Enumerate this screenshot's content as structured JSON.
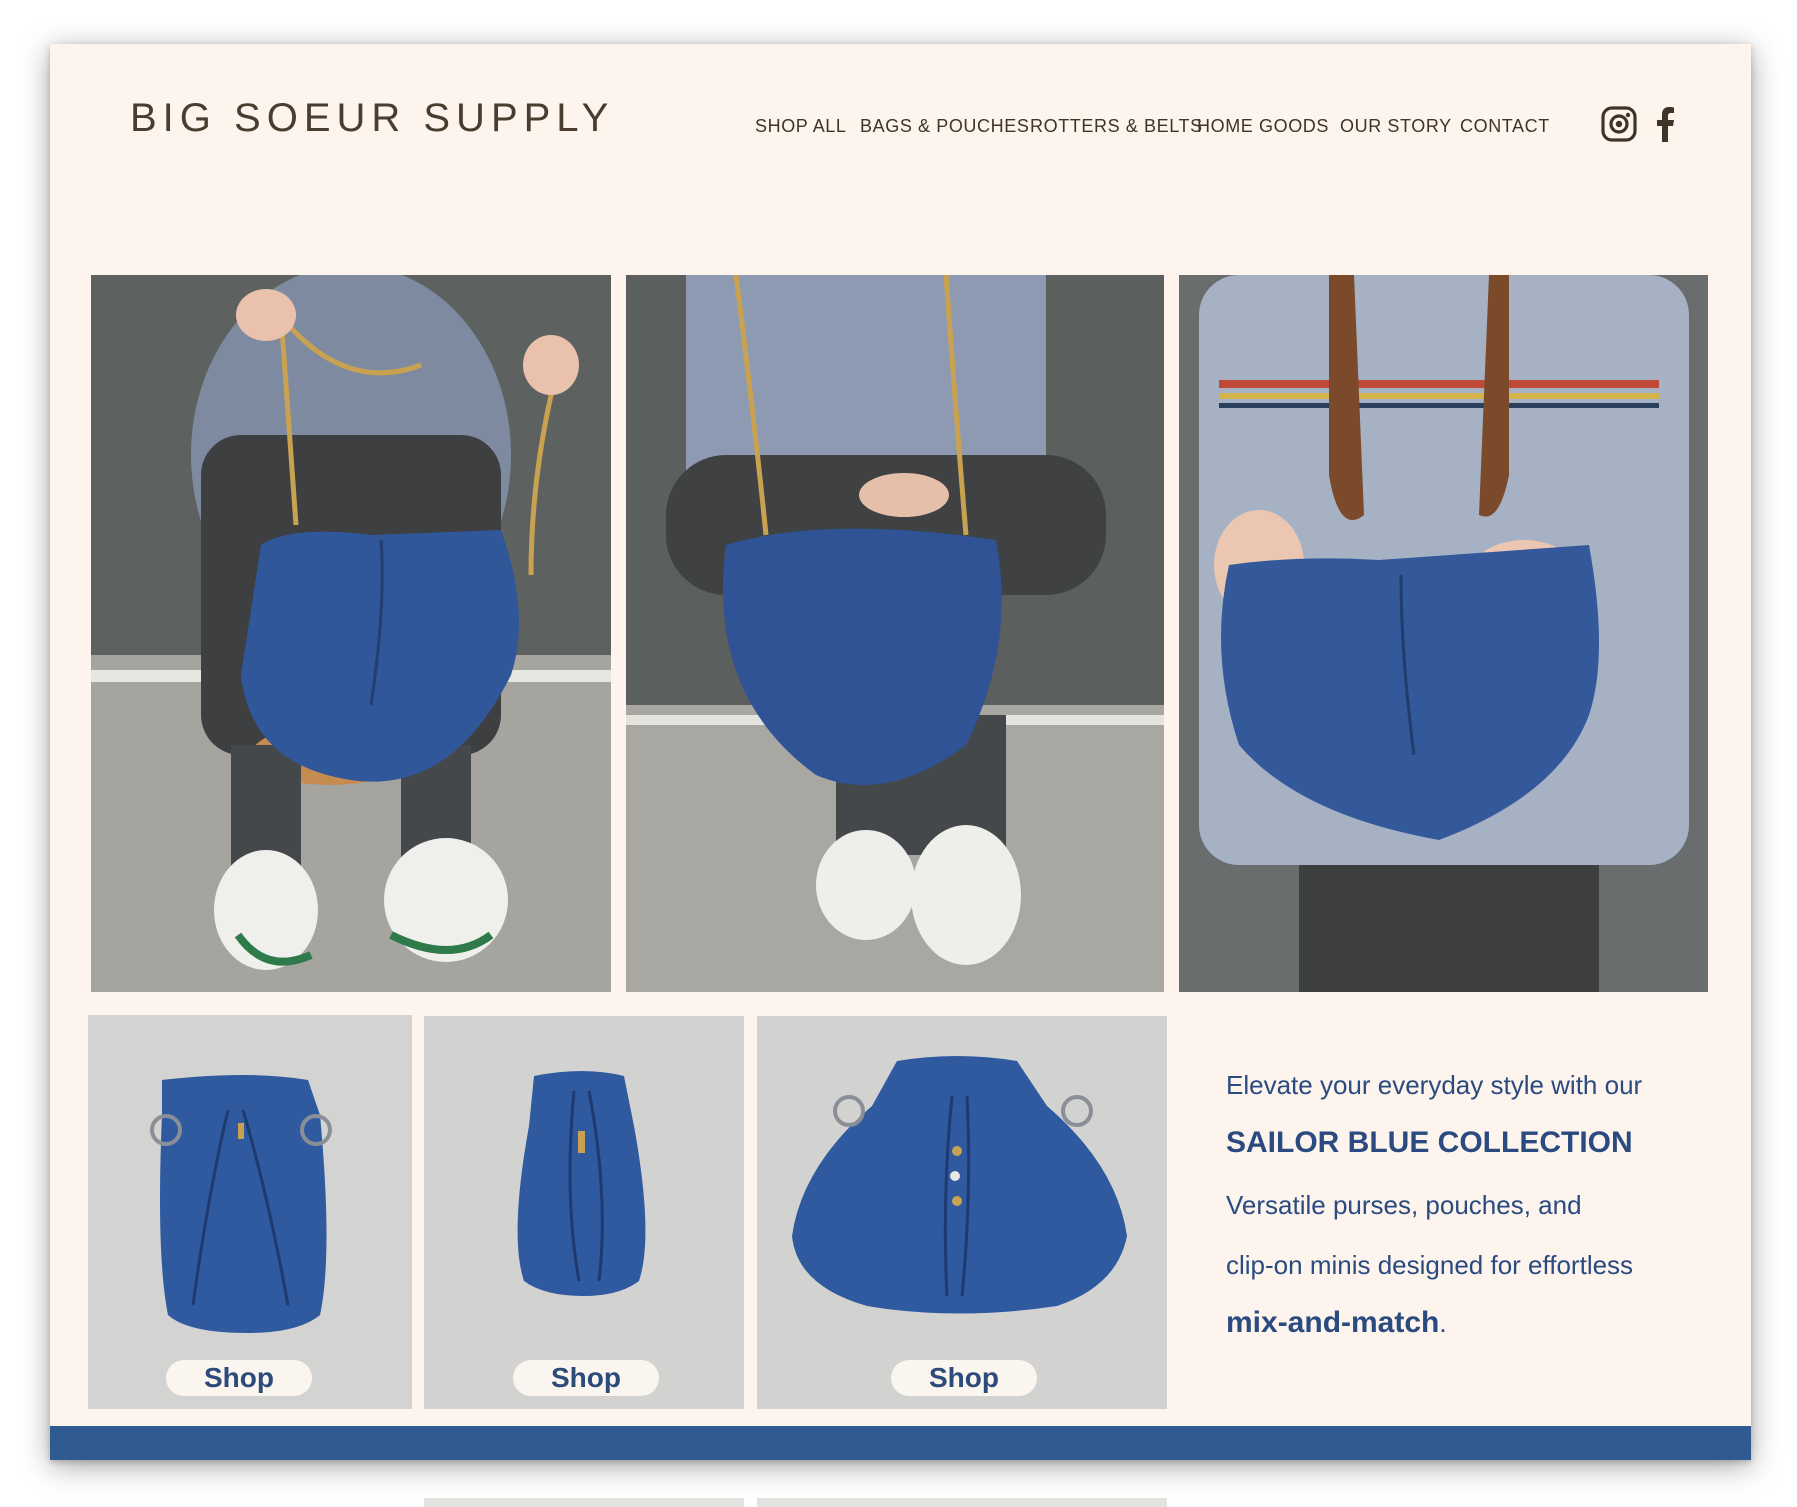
{
  "site": {
    "logo": "BIG SOEUR SUPPLY"
  },
  "nav": {
    "items": [
      {
        "label": "SHOP ALL"
      },
      {
        "label": "BAGS & POUCHES"
      },
      {
        "label": "ROTTERS & BELTS"
      },
      {
        "label": "HOME GOODS"
      },
      {
        "label": "OUR STORY"
      },
      {
        "label": "CONTACT"
      }
    ]
  },
  "social": {
    "icons": [
      "instagram-icon",
      "facebook-icon"
    ]
  },
  "products": [
    {
      "shop_label": "Shop"
    },
    {
      "shop_label": "Shop"
    },
    {
      "shop_label": "Shop"
    }
  ],
  "promo": {
    "line1": "Elevate your everyday style with our",
    "collection": "SAILOR BLUE COLLECTION",
    "line3": "Versatile purses, pouches, and",
    "line4": "clip-on minis designed for effortless",
    "emphasis": "mix-and-match",
    "period": "."
  },
  "colors": {
    "background": "#fcf4ed",
    "brand_blue": "#2f5b92",
    "text_blue": "#2a4a80",
    "logo_brown": "#4a3d30",
    "bag_blue": "#30579a"
  }
}
